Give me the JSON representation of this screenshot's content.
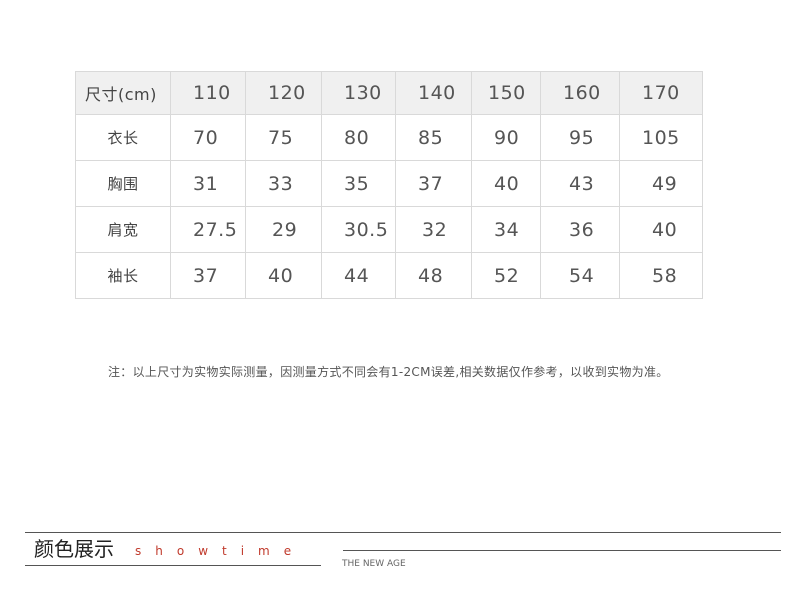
{
  "table": {
    "header": {
      "label": "尺寸(cm)",
      "sizes": [
        "110",
        "120",
        "130",
        "140",
        "150",
        "160",
        "170"
      ]
    },
    "rows": [
      {
        "label": "衣长",
        "values": [
          "70",
          "75",
          "80",
          "85",
          "90",
          "95",
          "105"
        ]
      },
      {
        "label": "胸围",
        "values": [
          "31",
          "33",
          "35",
          "37",
          "40",
          "43",
          "49"
        ]
      },
      {
        "label": "肩宽",
        "values": [
          "27.5",
          "29",
          "30.5",
          "32",
          "34",
          "36",
          "40"
        ]
      },
      {
        "label": "袖长",
        "values": [
          "37",
          "40",
          "44",
          "48",
          "52",
          "54",
          "58"
        ]
      }
    ]
  },
  "note": "注：以上尺寸为实物实际测量，因测量方式不同会有1-2CM误差,相关数据仅作参考，以收到实物为准。",
  "footer": {
    "title": "颜色展示",
    "subtitle": "showtime",
    "tagline": "THE NEW AGE"
  },
  "colors": {
    "header_bg": "#f0f0f0",
    "border": "#d9d9d9",
    "text": "#555555",
    "subtitle_accent": "#c0392b"
  }
}
